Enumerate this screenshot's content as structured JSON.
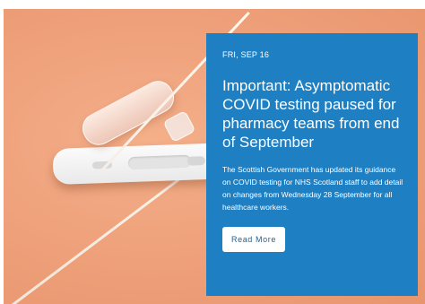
{
  "hero": {
    "image": "rapid-covid-test-kit-photo"
  },
  "card": {
    "date": "FRI, SEP 16",
    "title": "Important: Asymptomatic COVID testing paused for pharmacy teams from end of September",
    "summary": "The Scottish Government has updated its guidance on COVID testing for NHS Scotland staff to add detail on changes from Wednesday 28 September for all healthcare workers.",
    "button_label": "Read More",
    "background": "#1e7fc2"
  }
}
